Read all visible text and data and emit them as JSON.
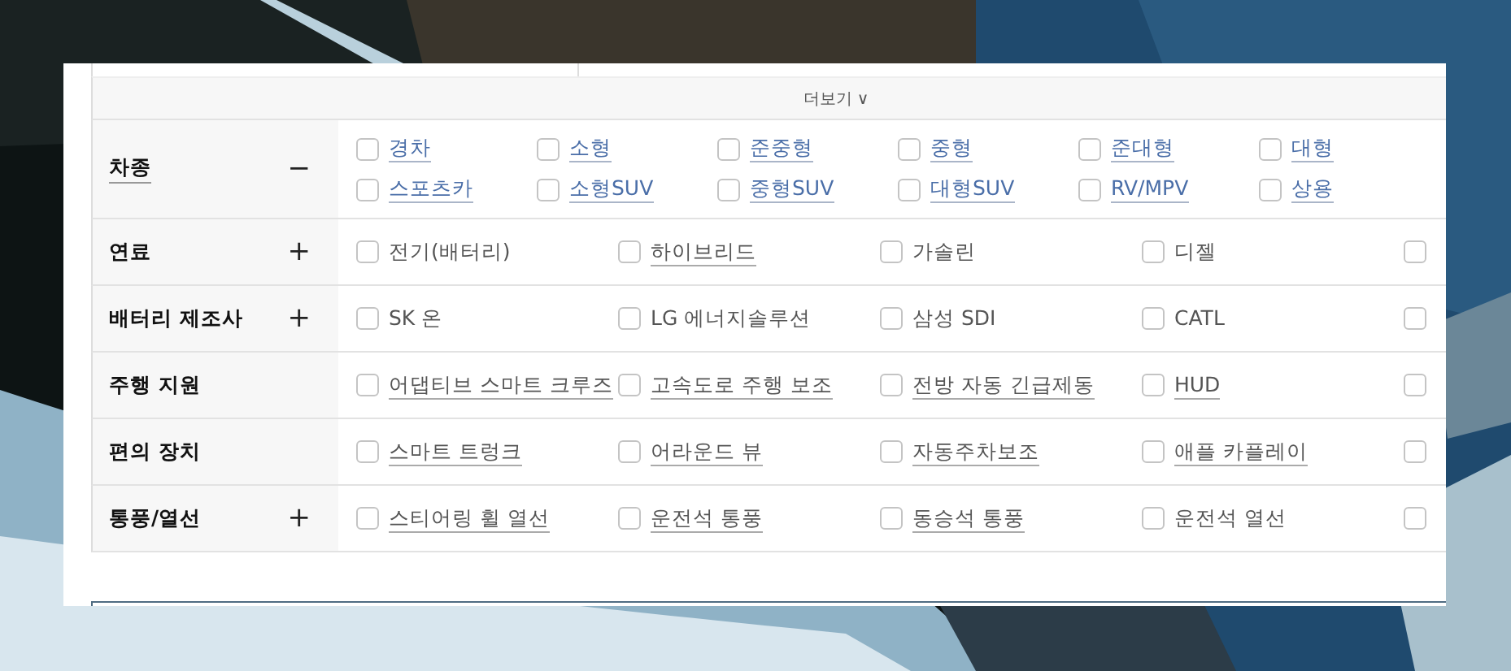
{
  "more_button": {
    "label": "더보기",
    "icon": "∨"
  },
  "filters": [
    {
      "label": "차종",
      "underlined": true,
      "toggle": "−",
      "kind": "compact",
      "options": [
        {
          "label": "경차",
          "kind": "blue-link",
          "checked": false
        },
        {
          "label": "소형",
          "kind": "blue-link",
          "checked": false
        },
        {
          "label": "준중형",
          "kind": "blue-link",
          "checked": false
        },
        {
          "label": "중형",
          "kind": "blue-link",
          "checked": false
        },
        {
          "label": "준대형",
          "kind": "blue-link",
          "checked": false
        },
        {
          "label": "대형",
          "kind": "blue-link",
          "checked": false
        },
        {
          "label": "스포츠카",
          "kind": "blue-link",
          "checked": false
        },
        {
          "label": "소형SUV",
          "kind": "blue-link",
          "checked": false
        },
        {
          "label": "중형SUV",
          "kind": "blue-link",
          "checked": false
        },
        {
          "label": "대형SUV",
          "kind": "blue-link",
          "checked": false
        },
        {
          "label": "RV/MPV",
          "kind": "blue-link",
          "checked": false
        },
        {
          "label": "상용",
          "kind": "blue-link",
          "checked": false
        }
      ]
    },
    {
      "label": "연료",
      "underlined": false,
      "toggle": "+",
      "kind": "wide",
      "options": [
        {
          "label": "전기(배터리)",
          "kind": "plain",
          "checked": false
        },
        {
          "label": "하이브리드",
          "kind": "link",
          "checked": false
        },
        {
          "label": "가솔린",
          "kind": "plain",
          "checked": false
        },
        {
          "label": "디젤",
          "kind": "plain",
          "checked": false
        },
        {
          "checked": false
        }
      ]
    },
    {
      "label": "배터리 제조사",
      "underlined": false,
      "toggle": "+",
      "kind": "wide",
      "options": [
        {
          "label": "SK 온",
          "kind": "plain",
          "checked": false
        },
        {
          "label": "LG 에너지솔루션",
          "kind": "plain",
          "checked": false
        },
        {
          "label": "삼성 SDI",
          "kind": "plain",
          "checked": false
        },
        {
          "label": "CATL",
          "kind": "plain",
          "checked": false
        },
        {
          "checked": false
        }
      ]
    },
    {
      "label": "주행 지원",
      "underlined": false,
      "kind": "wide",
      "options": [
        {
          "label": "어댑티브 스마트 크루즈",
          "kind": "link",
          "checked": false
        },
        {
          "label": "고속도로 주행 보조",
          "kind": "link",
          "checked": false
        },
        {
          "label": "전방 자동 긴급제동",
          "kind": "link",
          "checked": false
        },
        {
          "label": "HUD",
          "kind": "link",
          "checked": false
        },
        {
          "checked": false
        }
      ]
    },
    {
      "label": "편의 장치",
      "underlined": false,
      "kind": "wide",
      "options": [
        {
          "label": "스마트 트렁크",
          "kind": "link",
          "checked": false
        },
        {
          "label": "어라운드 뷰",
          "kind": "link",
          "checked": false
        },
        {
          "label": "자동주차보조",
          "kind": "link",
          "checked": false
        },
        {
          "label": "애플 카플레이",
          "kind": "link",
          "checked": false
        },
        {
          "checked": false
        }
      ]
    },
    {
      "label": "통풍/열선",
      "underlined": false,
      "toggle": "+",
      "kind": "wide",
      "options": [
        {
          "label": "스티어링 휠 열선",
          "kind": "link",
          "checked": false
        },
        {
          "label": "운전석 통풍",
          "kind": "link",
          "checked": false
        },
        {
          "label": "동승석 통풍",
          "kind": "link",
          "checked": false
        },
        {
          "label": "운전석 열선",
          "kind": "plain",
          "checked": false
        },
        {
          "checked": false
        }
      ]
    }
  ]
}
